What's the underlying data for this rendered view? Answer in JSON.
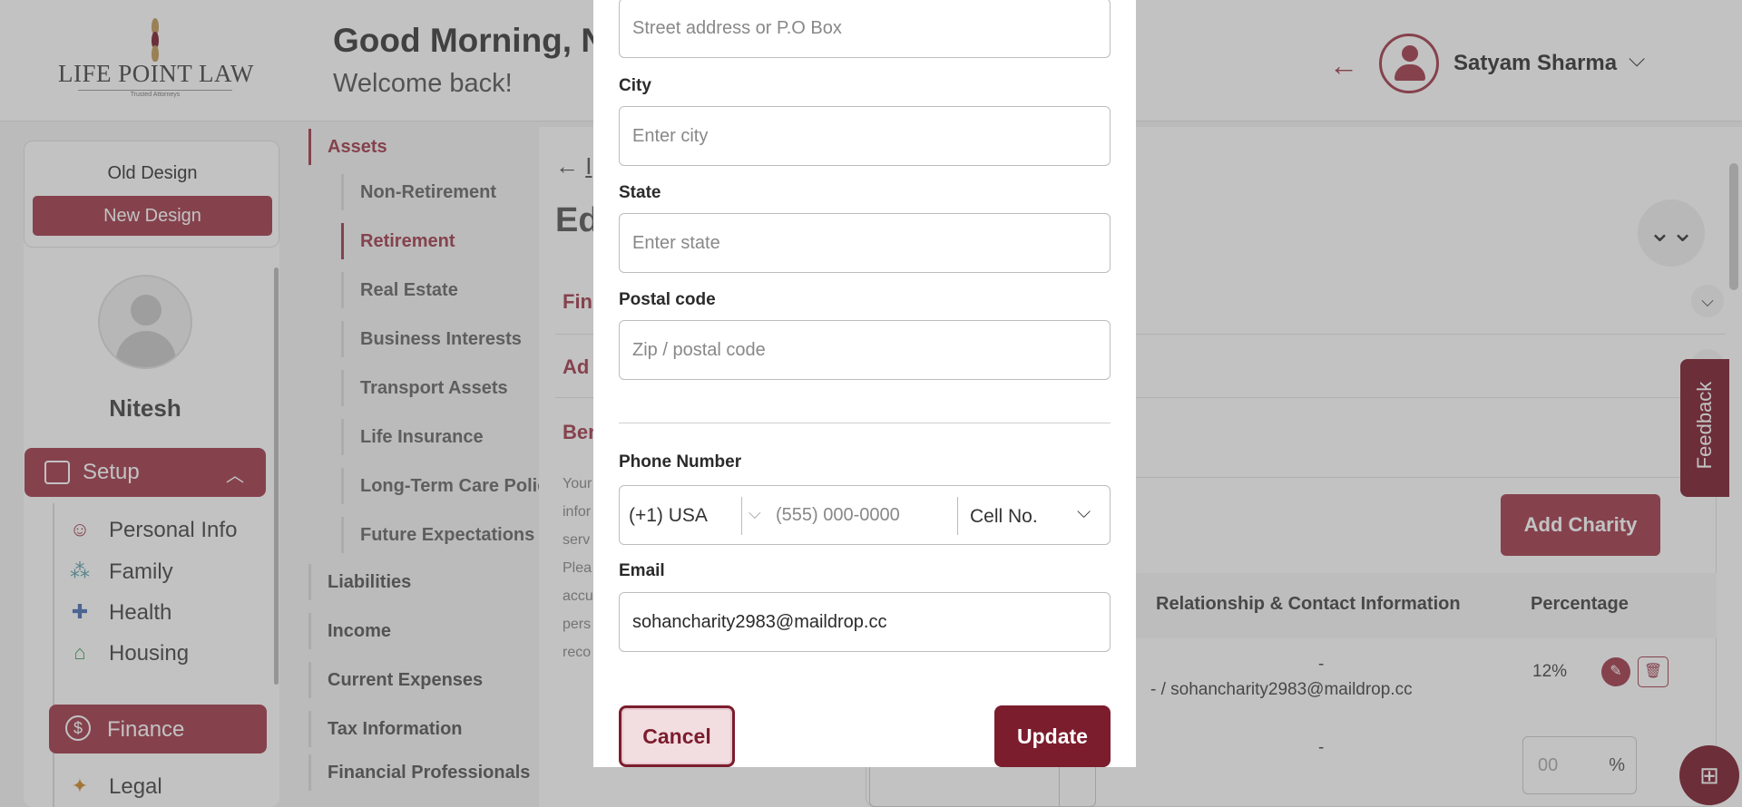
{
  "header": {
    "logo_text": "LIFE POINT LAW",
    "logo_tagline": "Trusted Attorneys",
    "greeting": "Good Morning, N",
    "welcome": "Welcome back!",
    "user_name": "Satyam Sharma"
  },
  "sidebar": {
    "old_design": "Old Design",
    "new_design": "New Design",
    "profile_name": "Nitesh",
    "setup_label": "Setup",
    "items": [
      {
        "label": "Personal Info",
        "icon": "person-icon"
      },
      {
        "label": "Family",
        "icon": "family-icon"
      },
      {
        "label": "Health",
        "icon": "health-icon"
      },
      {
        "label": "Housing",
        "icon": "house-icon"
      },
      {
        "label": "Finance",
        "icon": "dollar-icon"
      },
      {
        "label": "Legal",
        "icon": "legal-icon"
      }
    ]
  },
  "subnav": {
    "assets": "Assets",
    "asset_items": [
      "Non-Retirement",
      "Retirement",
      "Real Estate",
      "Business Interests",
      "Transport Assets",
      "Life Insurance",
      "Long-Term Care Policy",
      "Future Expectations"
    ],
    "sections": [
      "Liabilities",
      "Income",
      "Current Expenses",
      "Tax Information",
      "Financial Professionals"
    ]
  },
  "content": {
    "back_label": "I",
    "title": "Ed",
    "accordions": [
      "Fin",
      "Ad",
      "Ben"
    ],
    "notice_lines": [
      "Your",
      "infor",
      "serv",
      "Plea",
      "accu",
      "pers",
      "reco"
    ],
    "add_charity": "Add Charity",
    "table_headers": {
      "relationship": "Relationship & Contact Information",
      "percentage": "Percentage"
    },
    "rows": [
      {
        "rel_line1": "-",
        "rel_line2": "- / sohancharity2983@maildrop.cc",
        "percentage": "12%"
      },
      {
        "rel_line1": "-",
        "percentage_placeholder": "00",
        "percent_sign": "%"
      }
    ]
  },
  "feedback_label": "Feedback",
  "modal": {
    "address_placeholder": "Street address or P.O Box",
    "city_label": "City",
    "city_placeholder": "Enter city",
    "state_label": "State",
    "state_placeholder": "Enter state",
    "postal_label": "Postal code",
    "postal_placeholder": "Zip / postal code",
    "phone_label": "Phone Number",
    "country_code": "(+1) USA",
    "phone_placeholder": "(555) 000-0000",
    "phone_type": "Cell No.",
    "email_label": "Email",
    "email_value": "sohancharity2983@maildrop.cc",
    "cancel": "Cancel",
    "update": "Update"
  },
  "colors": {
    "brand": "#7b1d2d",
    "accent": "#a23b4c",
    "overlay": "rgba(80,80,80,0.35)"
  }
}
